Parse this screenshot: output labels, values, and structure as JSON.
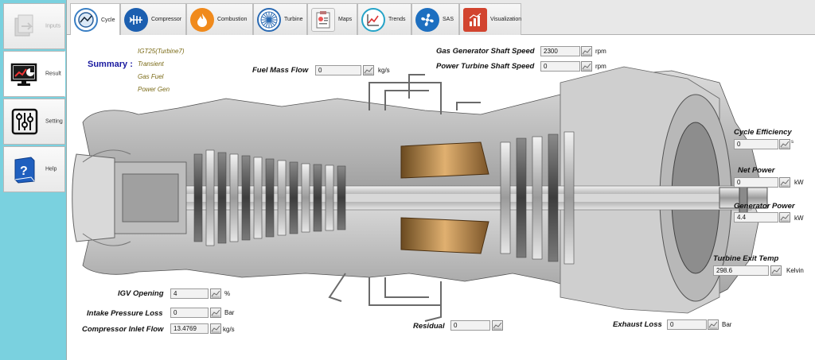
{
  "sidebar": {
    "items": [
      {
        "label": "Inputs",
        "icon": "inputs-icon",
        "state": "disabled"
      },
      {
        "label": "Result",
        "icon": "monitor-chart-icon",
        "state": "active"
      },
      {
        "label": "Setting",
        "icon": "sliders-icon",
        "state": "normal"
      },
      {
        "label": "Help",
        "icon": "help-book-icon",
        "state": "normal"
      }
    ]
  },
  "tabs": [
    {
      "label": "Cycle",
      "icon": "cycle-icon",
      "active": true
    },
    {
      "label": "Compressor",
      "icon": "compressor-icon"
    },
    {
      "label": "Combustion",
      "icon": "flame-icon"
    },
    {
      "label": "Turbine",
      "icon": "turbine-icon"
    },
    {
      "label": "Maps",
      "icon": "maps-icon"
    },
    {
      "label": "Trends",
      "icon": "trends-icon"
    },
    {
      "label": "SAS",
      "icon": "fan-icon"
    },
    {
      "label": "Visualization",
      "icon": "visualization-icon"
    }
  ],
  "summary": {
    "title": "Summary :",
    "lines": [
      "IGT25(Turbine7)",
      "Transient",
      "Gas Fuel",
      "Power Gen"
    ]
  },
  "fields": {
    "fuel_mass_flow": {
      "label": "Fuel Mass Flow",
      "value": "0",
      "unit": "kg/s"
    },
    "gas_gen_speed": {
      "label": "Gas Generator Shaft Speed",
      "value": "2300",
      "unit": "rpm"
    },
    "power_turbine_speed": {
      "label": "Power Turbine Shaft Speed",
      "value": "0",
      "unit": "rpm"
    },
    "cycle_efficiency": {
      "label": "Cycle Efficiency",
      "value": "0",
      "unit": "s"
    },
    "net_power": {
      "label": "Net Power",
      "value": "0",
      "unit": "kW"
    },
    "generator_power": {
      "label": "Generator Power",
      "value": "4.4",
      "unit": "kW"
    },
    "turbine_exit_temp": {
      "label": "Turbine Exit Temp",
      "value": "298.6",
      "unit": "Kelvin"
    },
    "igv_opening": {
      "label": "IGV Opening",
      "value": "4",
      "unit": "%"
    },
    "intake_pressure_loss": {
      "label": "Intake Pressure Loss",
      "value": "0",
      "unit": "Bar"
    },
    "compressor_inlet_flow": {
      "label": "Compressor Inlet Flow",
      "value": "13.4769",
      "unit": "kg/s"
    },
    "residual": {
      "label": "Residual",
      "value": "0",
      "unit": ""
    },
    "exhaust_loss": {
      "label": "Exhaust  Loss",
      "value": "0",
      "unit": "Bar"
    }
  },
  "colors": {
    "sidebar_bg": "#7ad1df",
    "summary_title": "#1a1aa0",
    "summary_text": "#7a6a16"
  }
}
